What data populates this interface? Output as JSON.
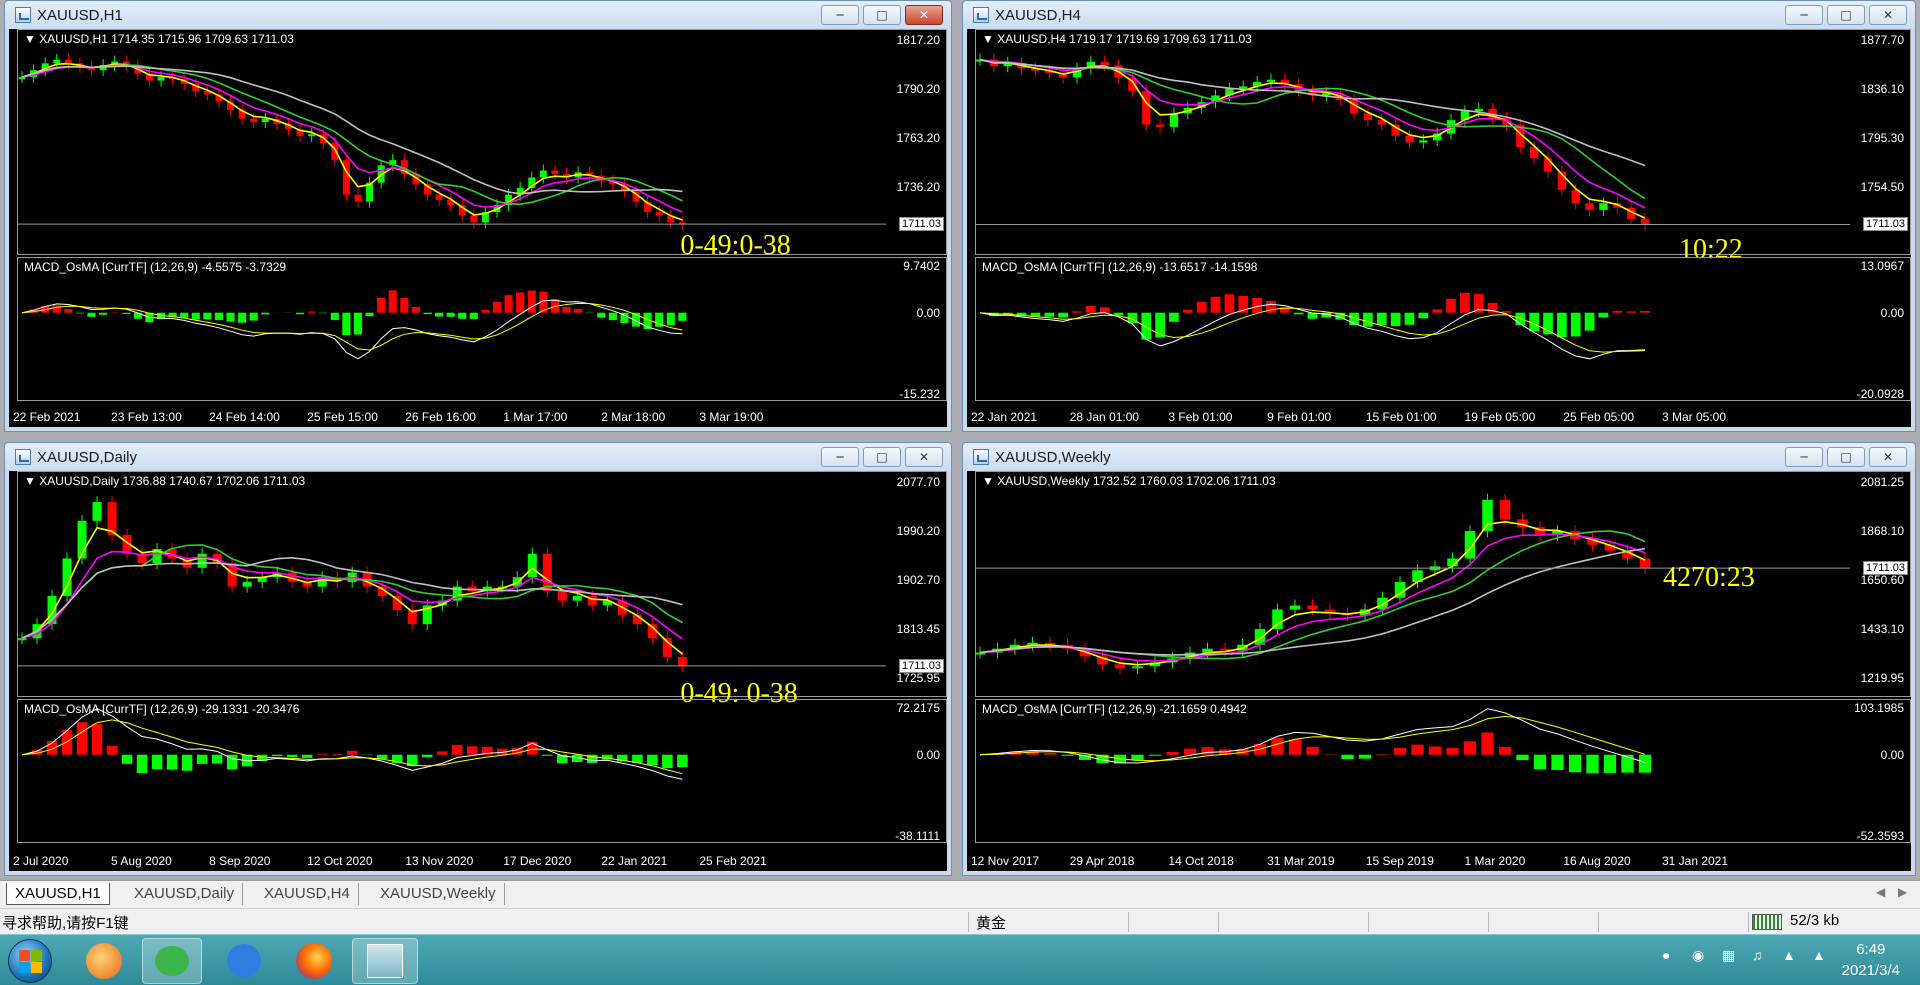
{
  "windows": {
    "h1": {
      "title": "XAUUSD,H1",
      "header": "XAUUSD,H1  1714.35 1715.96 1709.63 1711.03",
      "price_ticks": [
        "1817.20",
        "1790.20",
        "1763.20",
        "1736.20"
      ],
      "current_price": "1711.03",
      "timer": "0-49:0-38",
      "macd_header": "MACD_OsMA [CurrTF] (12,26,9) -4.5575 -3.7329",
      "macd_ticks": [
        "9.7402",
        "0.00",
        "-15.232"
      ],
      "dates": [
        "22 Feb 2021",
        "23 Feb 13:00",
        "24 Feb 14:00",
        "25 Feb 15:00",
        "26 Feb 16:00",
        "1 Mar 17:00",
        "2 Mar 18:00",
        "3 Mar 19:00"
      ],
      "series": [
        1796,
        1800,
        1804,
        1806,
        1804,
        1802,
        1800,
        1803,
        1805,
        1803,
        1798,
        1794,
        1796,
        1795,
        1792,
        1788,
        1786,
        1782,
        1777,
        1772,
        1770,
        1772,
        1769,
        1766,
        1762,
        1763,
        1758,
        1748,
        1728,
        1724,
        1735,
        1745,
        1748,
        1740,
        1734,
        1728,
        1725,
        1722,
        1716,
        1712,
        1718,
        1722,
        1728,
        1732,
        1738,
        1742,
        1740,
        1738,
        1741,
        1739,
        1736,
        1734,
        1730,
        1724,
        1718,
        1716,
        1712,
        1711
      ]
    },
    "h4": {
      "title": "XAUUSD,H4",
      "header": "XAUUSD,H4  1719.17 1719.69 1709.63 1711.03",
      "price_ticks": [
        "1877.70",
        "1836.10",
        "1795.30",
        "1754.50"
      ],
      "current_price": "1711.03",
      "timer": "10:22",
      "macd_header": "MACD_OsMA [CurrTF] (12,26,9) -13.6517 -14.1598",
      "macd_ticks": [
        "13.0967",
        "0.00",
        "-20.0928"
      ],
      "dates": [
        "22 Jan 2021",
        "28 Jan 01:00",
        "3 Feb 01:00",
        "9 Feb 01:00",
        "15 Feb 01:00",
        "19 Feb 05:00",
        "25 Feb 05:00",
        "3 Mar 05:00"
      ],
      "series": [
        1858,
        1852,
        1855,
        1850,
        1848,
        1846,
        1842,
        1850,
        1856,
        1853,
        1842,
        1830,
        1800,
        1798,
        1810,
        1815,
        1820,
        1826,
        1832,
        1834,
        1838,
        1840,
        1836,
        1830,
        1826,
        1828,
        1822,
        1810,
        1804,
        1800,
        1790,
        1784,
        1786,
        1792,
        1804,
        1812,
        1814,
        1806,
        1800,
        1780,
        1770,
        1758,
        1742,
        1730,
        1724,
        1730,
        1726,
        1716,
        1711
      ]
    },
    "daily": {
      "title": "XAUUSD,Daily",
      "header": "XAUUSD,Daily  1736.88 1740.67 1702.06 1711.03",
      "price_ticks": [
        "2077.70",
        "1990.20",
        "1902.70",
        "1813.45",
        "1725.95"
      ],
      "current_price": "1711.03",
      "timer": "0-49: 0-38",
      "macd_header": "MACD_OsMA [CurrTF] (12,26,9) -29.1331 -20.3476",
      "macd_ticks": [
        "72.2175",
        "0.00",
        "-38.1111"
      ],
      "dates": [
        "2 Jul 2020",
        "5 Aug 2020",
        "8 Sep 2020",
        "12 Oct 2020",
        "13 Nov 2020",
        "17 Dec 2020",
        "22 Jan 2021",
        "25 Feb 2021"
      ],
      "series": [
        1770,
        1800,
        1860,
        1940,
        2020,
        2060,
        1990,
        1950,
        1930,
        1960,
        1940,
        1920,
        1950,
        1930,
        1880,
        1890,
        1900,
        1910,
        1890,
        1880,
        1900,
        1890,
        1910,
        1880,
        1860,
        1830,
        1800,
        1840,
        1850,
        1880,
        1870,
        1880,
        1880,
        1900,
        1950,
        1870,
        1850,
        1860,
        1840,
        1850,
        1820,
        1800,
        1770,
        1730,
        1711
      ]
    },
    "weekly": {
      "title": "XAUUSD,Weekly",
      "header": "XAUUSD,Weekly  1732.52 1760.03 1702.06 1711.03",
      "price_ticks": [
        "2081.25",
        "1868.10",
        "1650.60",
        "1433.10",
        "1219.95"
      ],
      "current_price": "1711.03",
      "timer": "4270:23",
      "macd_header": "MACD_OsMA [CurrTF] (12,26,9) -21.1659 0.4942",
      "macd_ticks": [
        "103.1985",
        "0.00",
        "-52.3593"
      ],
      "dates": [
        "12 Nov 2017",
        "29 Apr 2018",
        "14 Oct 2018",
        "31 Mar 2019",
        "15 Sep 2019",
        "1 Mar 2020",
        "16 Aug 2020",
        "31 Jan 2021"
      ],
      "series": [
        1280,
        1300,
        1320,
        1330,
        1320,
        1300,
        1260,
        1220,
        1200,
        1210,
        1230,
        1250,
        1280,
        1300,
        1290,
        1320,
        1400,
        1500,
        1520,
        1500,
        1480,
        1470,
        1500,
        1560,
        1640,
        1700,
        1720,
        1760,
        1900,
        2060,
        1960,
        1920,
        1880,
        1900,
        1860,
        1830,
        1800,
        1760,
        1711
      ]
    }
  },
  "tabs": [
    "XAUUSD,H1",
    "XAUUSD,Daily",
    "XAUUSD,H4",
    "XAUUSD,Weekly"
  ],
  "status": {
    "help": "寻求帮助,请按F1键",
    "profile": "黄金",
    "traffic": "52/3 kb"
  },
  "clock": {
    "time": "6:49",
    "date": "2021/3/4"
  },
  "colors": {
    "candle_up": "#00ff00",
    "candle_down": "#ff0000",
    "ma_fast": "#ffff00",
    "ma_mid": "#ff00ff",
    "ma_slow": "#32cd32",
    "ma_long": "#c0c0c0",
    "timer": "#ffff00"
  }
}
